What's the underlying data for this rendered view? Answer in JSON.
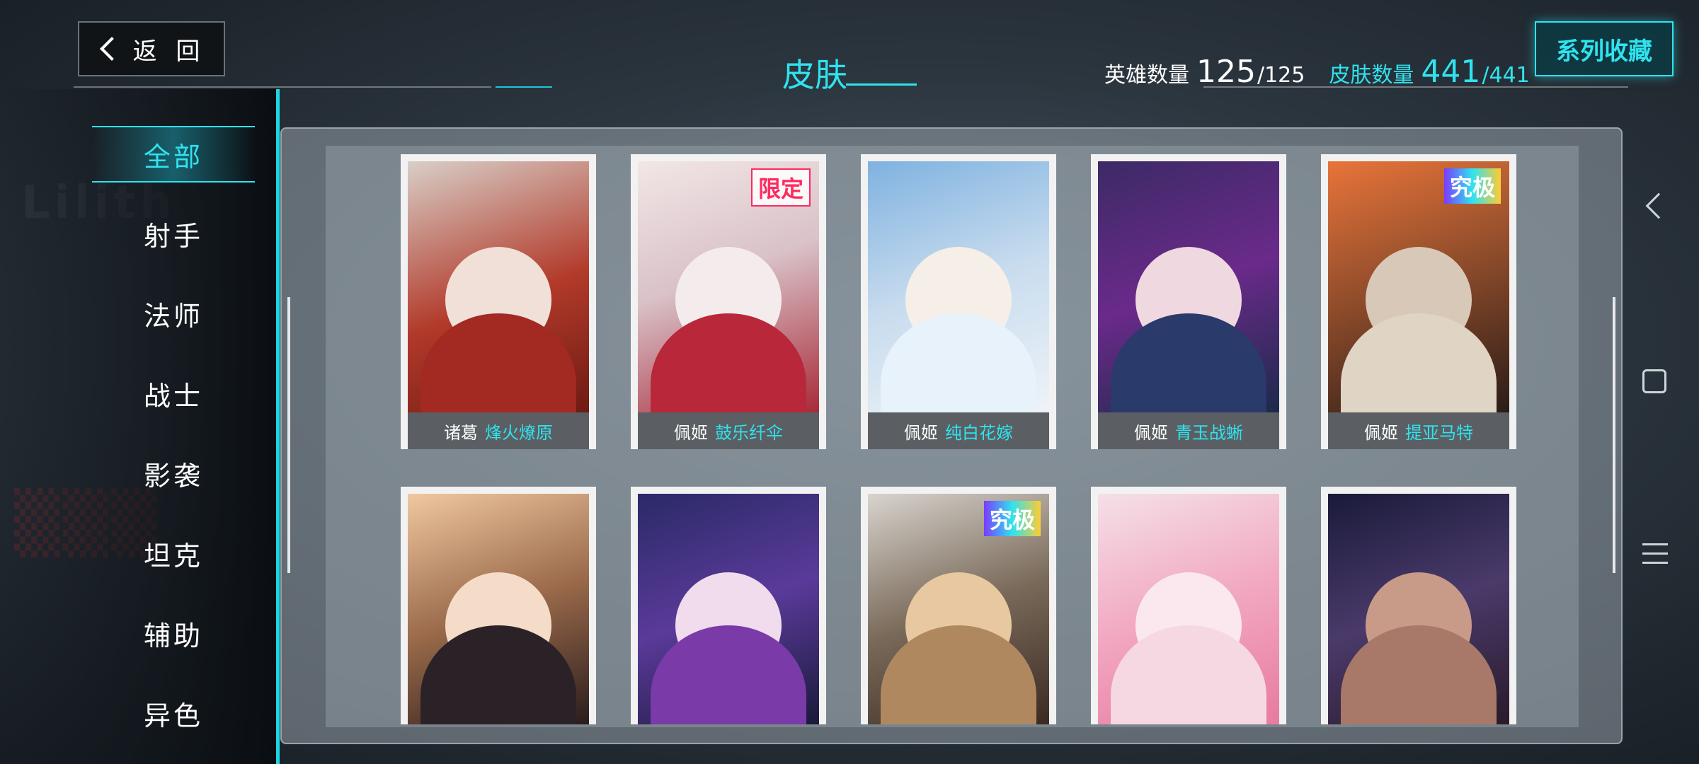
{
  "header": {
    "back_label": "返 回",
    "title": "皮肤",
    "hero_count_label": "英雄数量",
    "hero_count_value": "125",
    "hero_count_total": "/125",
    "skin_count_label": "皮肤数量",
    "skin_count_value": "441",
    "skin_count_total": "/441",
    "series_button": "系列收藏"
  },
  "sidebar": {
    "items": [
      {
        "label": "全部",
        "active": true
      },
      {
        "label": "射手"
      },
      {
        "label": "法师"
      },
      {
        "label": "战士"
      },
      {
        "label": "影袭"
      },
      {
        "label": "坦克"
      },
      {
        "label": "辅助"
      },
      {
        "label": "异色"
      }
    ]
  },
  "skins": {
    "row1": [
      {
        "hero": "诸葛",
        "skin": "烽火燎原"
      },
      {
        "hero": "佩姬",
        "skin": "鼓乐纤伞",
        "badge": "限定"
      },
      {
        "hero": "佩姬",
        "skin": "纯白花嫁"
      },
      {
        "hero": "佩姬",
        "skin": "青玉战蜥"
      },
      {
        "hero": "佩姬",
        "skin": "提亚马特",
        "badge": "究极"
      }
    ],
    "row2": [
      {},
      {},
      {
        "badge": "究极"
      },
      {},
      {}
    ]
  },
  "colors": {
    "accent": "#2fe3ef",
    "caption_bg": "#5b5f63"
  }
}
